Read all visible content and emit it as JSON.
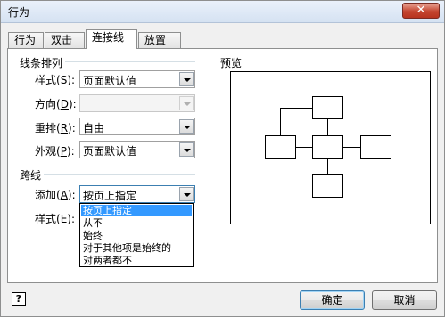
{
  "window": {
    "title": "行为",
    "close_glyph": "✕"
  },
  "tabs": [
    {
      "label": "行为"
    },
    {
      "label": "双击"
    },
    {
      "label": "连接线"
    },
    {
      "label": "放置"
    }
  ],
  "routing": {
    "section_title": "线条排列",
    "style_label_pre": "样式",
    "style_label_key": "S",
    "style_value": "页面默认值",
    "direction_label_pre": "方向",
    "direction_label_key": "D",
    "direction_value": "",
    "reroute_label_pre": "重排",
    "reroute_label_key": "R",
    "reroute_value": "自由",
    "appearance_label_pre": "外观",
    "appearance_label_key": "P",
    "appearance_value": "页面默认值"
  },
  "jumps": {
    "section_title": "跨线",
    "add_label_pre": "添加",
    "add_label_key": "A",
    "add_value": "按页上指定",
    "style_label_pre": "样式",
    "style_label_key": "E",
    "options": [
      "按页上指定",
      "从不",
      "始终",
      "对于其他项是始终的",
      "对两者都不"
    ],
    "selected_option": "按页上指定"
  },
  "preview": {
    "title": "预览"
  },
  "buttons": {
    "ok": "确定",
    "cancel": "取消",
    "help": "?"
  },
  "icons": {
    "help": "help-icon",
    "close": "close-icon",
    "dropdown": "chevron-down-icon"
  }
}
